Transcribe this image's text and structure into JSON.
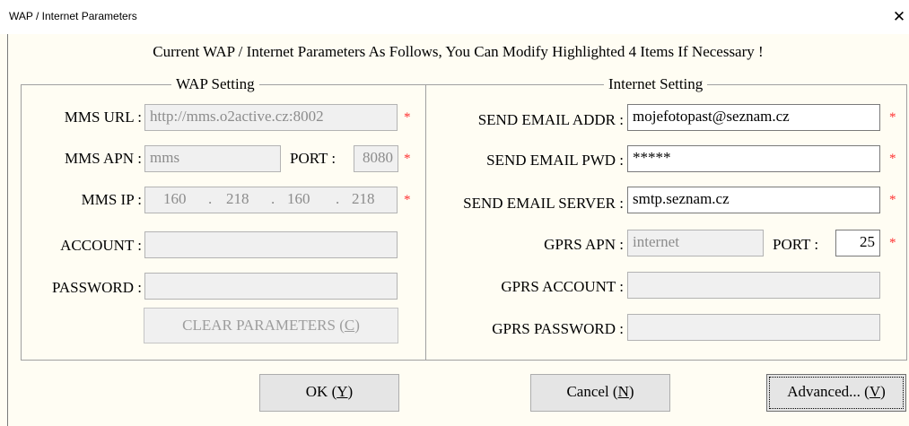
{
  "window": {
    "title": "WAP / Internet Parameters",
    "close_glyph": "✕"
  },
  "headline": "Current WAP / Internet Parameters As Follows, You Can Modify Highlighted 4 Items If Necessary !",
  "required_mark": "*",
  "wap": {
    "title": "WAP Setting",
    "mms_url_label": "MMS URL :",
    "mms_url_value": "http://mms.o2active.cz:8002",
    "mms_apn_label": "MMS APN :",
    "mms_apn_value": "mms",
    "port_label": "PORT :",
    "port_value": "8080",
    "mms_ip_label": "MMS IP :",
    "ip": [
      "160",
      "218",
      "160",
      "218"
    ],
    "ip_dot": ".",
    "account_label": "ACCOUNT :",
    "account_value": "",
    "password_label": "PASSWORD :",
    "password_value": "",
    "clear_prefix": "CLEAR PARAMETERS (",
    "clear_key": "C",
    "clear_suffix": ")"
  },
  "internet": {
    "title": "Internet Setting",
    "send_email_addr_label": "SEND EMAIL ADDR :",
    "send_email_addr_value": "mojefotopast@seznam.cz",
    "send_email_pwd_label": "SEND EMAIL PWD :",
    "send_email_pwd_value": "*****",
    "send_email_server_label": "SEND EMAIL SERVER :",
    "send_email_server_value": "smtp.seznam.cz",
    "gprs_apn_label": "GPRS APN :",
    "gprs_apn_value": "internet",
    "port_label": "PORT :",
    "port_value": "25",
    "gprs_account_label": "GPRS ACCOUNT :",
    "gprs_account_value": "",
    "gprs_password_label": "GPRS PASSWORD :",
    "gprs_password_value": ""
  },
  "buttons": {
    "ok_prefix": "OK (",
    "ok_key": "Y",
    "ok_suffix": ")",
    "cancel_prefix": "Cancel (",
    "cancel_key": "N",
    "cancel_suffix": ")",
    "advanced_prefix": "Advanced... (",
    "advanced_key": "V",
    "advanced_suffix": ")"
  }
}
